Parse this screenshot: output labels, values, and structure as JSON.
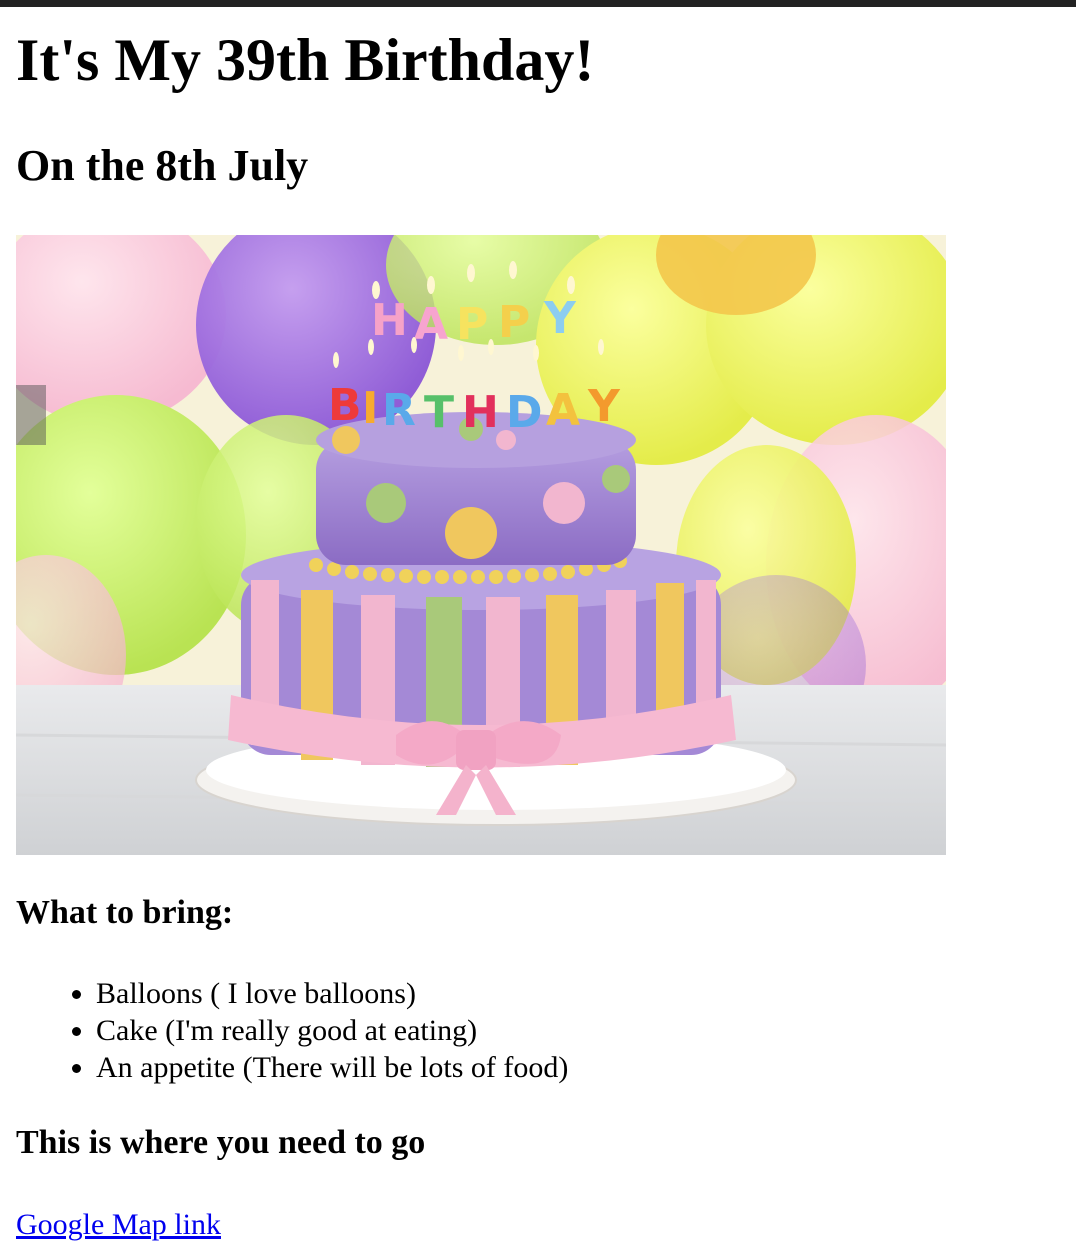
{
  "page": {
    "title": "It's My 39th Birthday!",
    "subtitle": "On the 8th July"
  },
  "hero_image": {
    "cake_letters_top": "HAPPY",
    "cake_letters_bottom": "BIRTHDAY"
  },
  "bring": {
    "heading": "What to bring:",
    "items": [
      "Balloons ( I love balloons)",
      "Cake (I'm really good at eating)",
      "An appetite (There will be lots of food)"
    ]
  },
  "location": {
    "heading": "This is where you need to go",
    "link_label": "Google Map link"
  },
  "colors": {
    "link": "#0000ee",
    "cake_purple": "#9b7fc9",
    "cake_pink": "#f2b6cf",
    "cake_yellow": "#f0c75e",
    "cake_green": "#a9c97a"
  }
}
